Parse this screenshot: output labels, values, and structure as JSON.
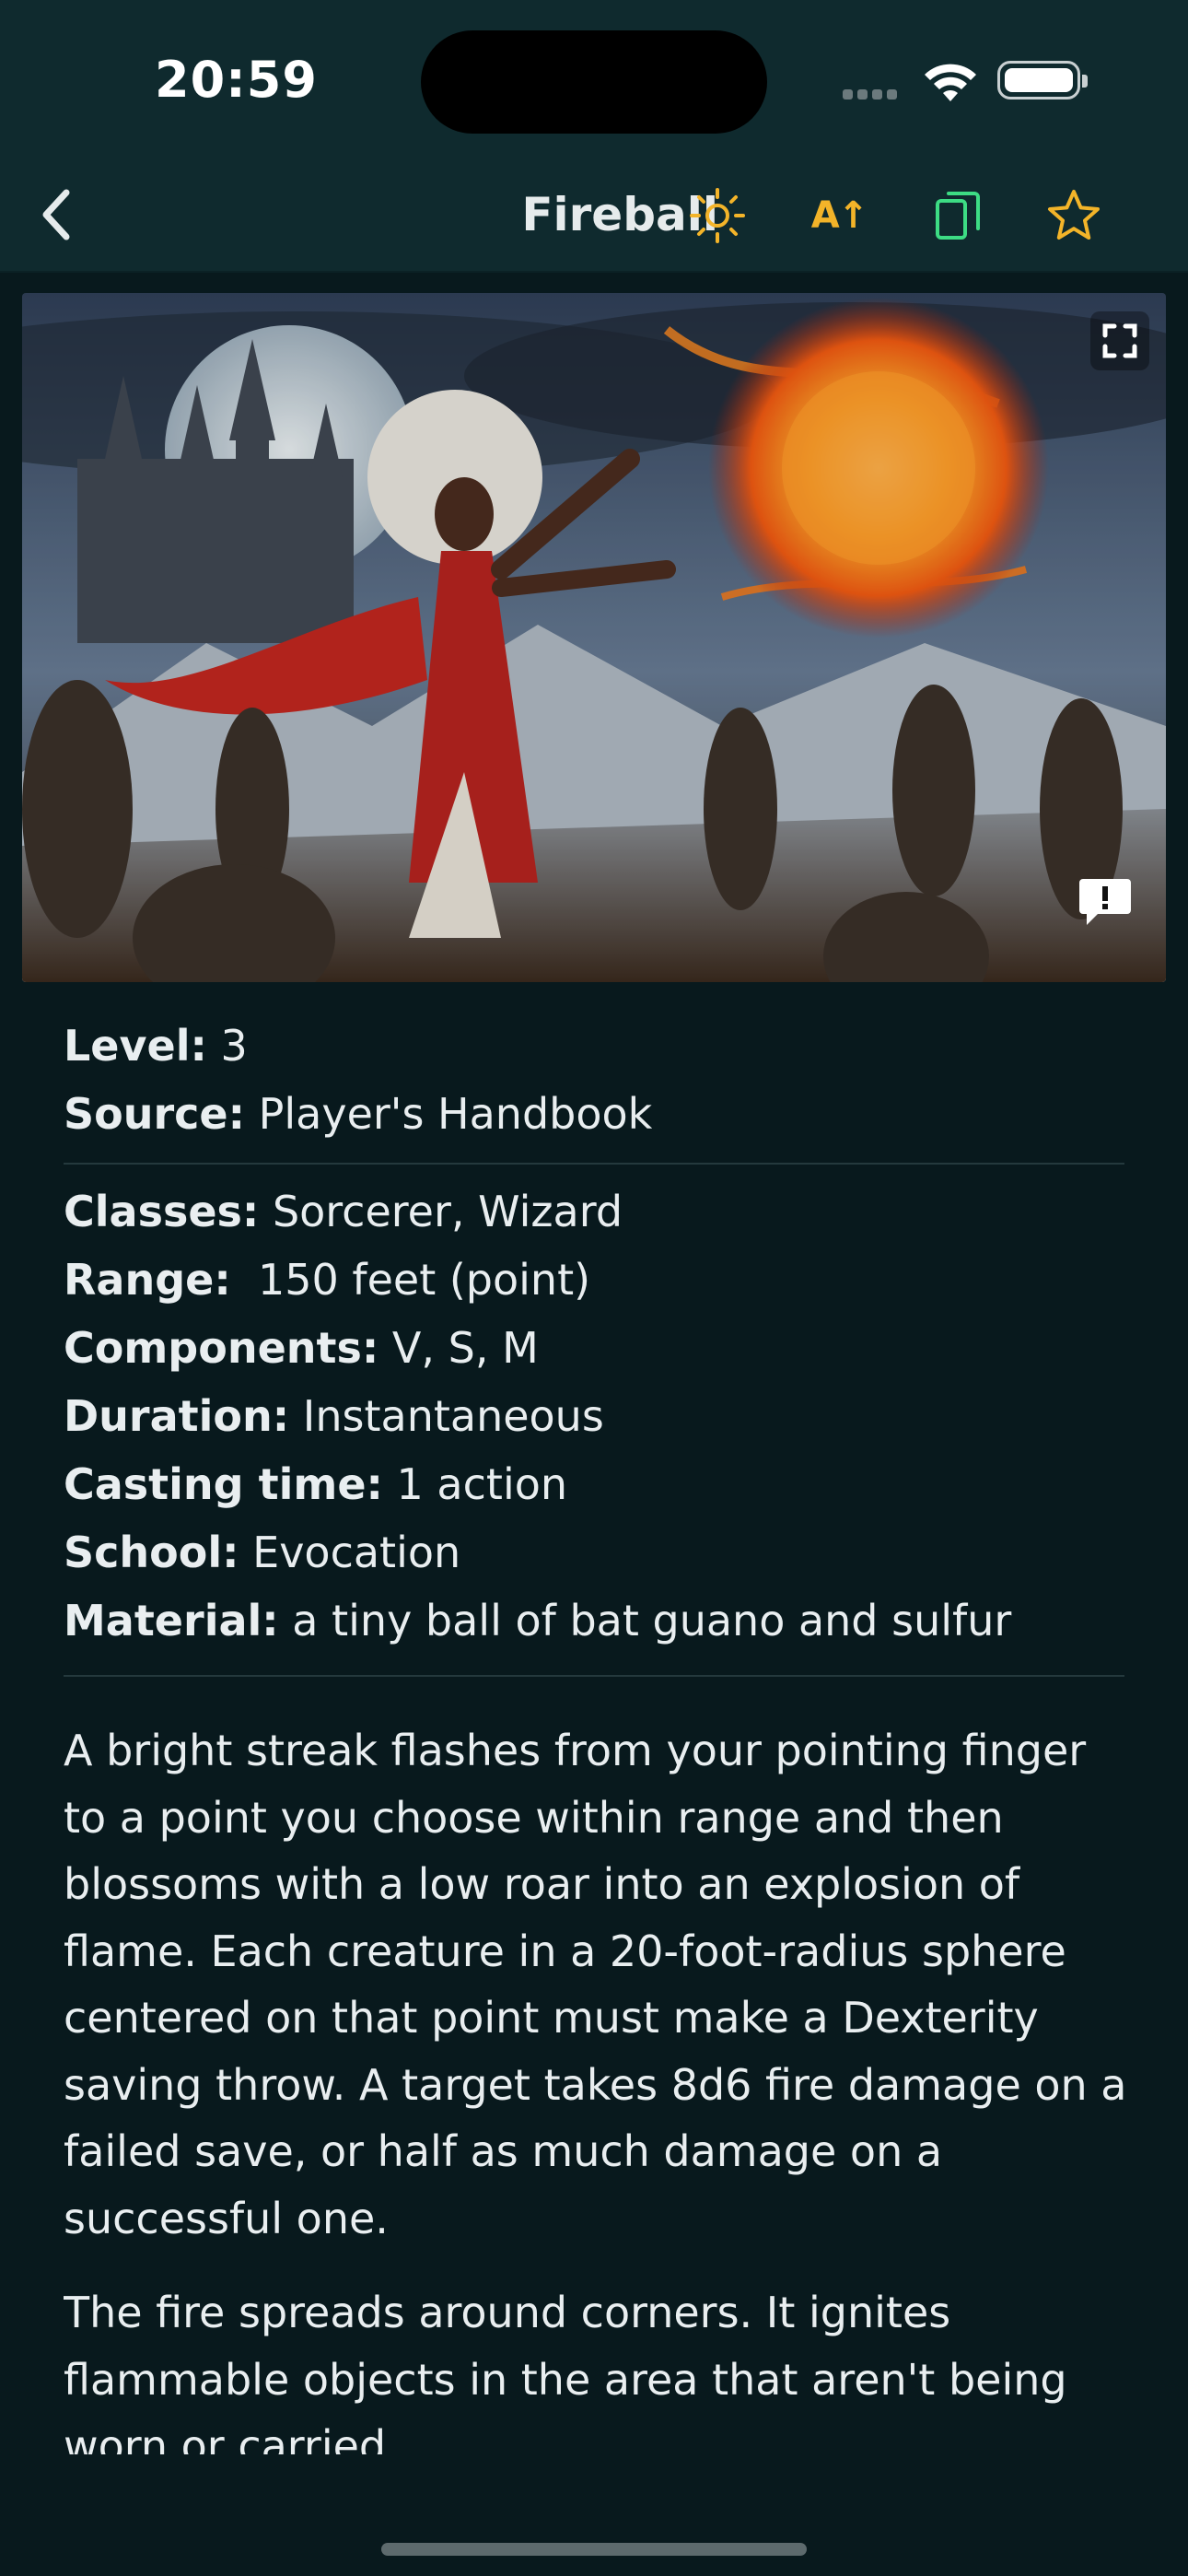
{
  "status_bar": {
    "time": "20:59"
  },
  "nav": {
    "title": "Fireball",
    "icons": [
      "back-chevron",
      "sun",
      "text-size",
      "copy",
      "star"
    ],
    "text_size_label": "A↑",
    "accent": "#f3b429",
    "copy_color": "#3ddc84"
  },
  "hero_image": {
    "alt": "Fireball spell illustration"
  },
  "spell": {
    "level_label": "Level:",
    "level": "3",
    "source_label": "Source:",
    "source": "Player's Handbook",
    "classes_label": "Classes:",
    "classes": "Sorcerer, Wizard",
    "range_label": "Range:",
    "range": "150 feet (point)",
    "components_label": "Components:",
    "components": "V, S, M",
    "duration_label": "Duration:",
    "duration": "Instantaneous",
    "casting_time_label": "Casting time:",
    "casting_time": "1 action",
    "school_label": "School:",
    "school": "Evocation",
    "material_label": "Material:",
    "material": "a tiny ball of bat guano and sulfur",
    "description": [
      "A bright streak flashes from your pointing finger to a point you choose within range and then blossoms with a low roar into an explosion of flame. Each creature in a 20-foot-radius sphere centered on that point must make a Dexterity saving throw. A target takes 8d6 fire damage on a failed save, or half as much damage on a successful one.",
      "The fire spreads around corners. It ignites flammable objects in the area that aren't being worn or carried."
    ]
  }
}
